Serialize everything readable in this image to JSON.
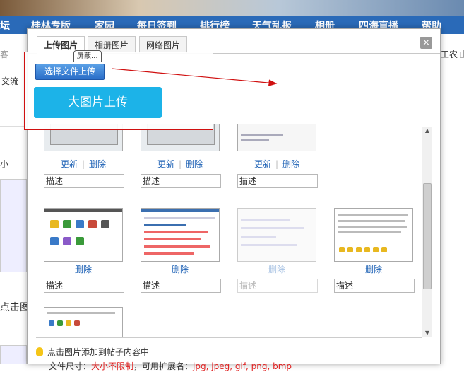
{
  "nav": {
    "items": [
      "坛",
      "桂林专版",
      "家园",
      "每日签到",
      "排行榜",
      "天气乱报",
      "相册",
      "四海直播",
      "帮助"
    ]
  },
  "background": {
    "left_texts": [
      "客",
      "交流",
      "小",
      "点击图"
    ],
    "right_texts": [
      "工农",
      "山"
    ]
  },
  "dialog": {
    "tabs": [
      "上传图片",
      "相册图片",
      "网络图片"
    ],
    "close_label": "×",
    "upload": {
      "badge": "屏蔽...",
      "select_button": "选择文件上传",
      "big_button": "大图片上传"
    },
    "row1": [
      {
        "update": "更新",
        "delete": "删除",
        "desc": "描述"
      },
      {
        "update": "更新",
        "delete": "删除",
        "desc": "描述"
      },
      {
        "update": "更新",
        "delete": "删除",
        "desc": "描述"
      }
    ],
    "row2": [
      {
        "delete": "删除",
        "desc": "描述",
        "disabled": false
      },
      {
        "delete": "删除",
        "desc": "描述",
        "disabled": false
      },
      {
        "delete": "删除",
        "desc": "描述",
        "disabled": true
      },
      {
        "delete": "删除",
        "desc": "描述",
        "disabled": false
      }
    ],
    "tip": "点击图片添加到帖子内容中",
    "fileinfo": {
      "prefix": "文件尺寸：",
      "size": "大小不限制",
      "middle": "，可用扩展名：",
      "exts": "jpg, jpeg, gif, png, bmp"
    }
  },
  "colors": {
    "nav_bg": "#2a6ab8",
    "accent_red": "#d01010",
    "big_button": "#1cb3e8",
    "link": "#1a5fb4"
  }
}
